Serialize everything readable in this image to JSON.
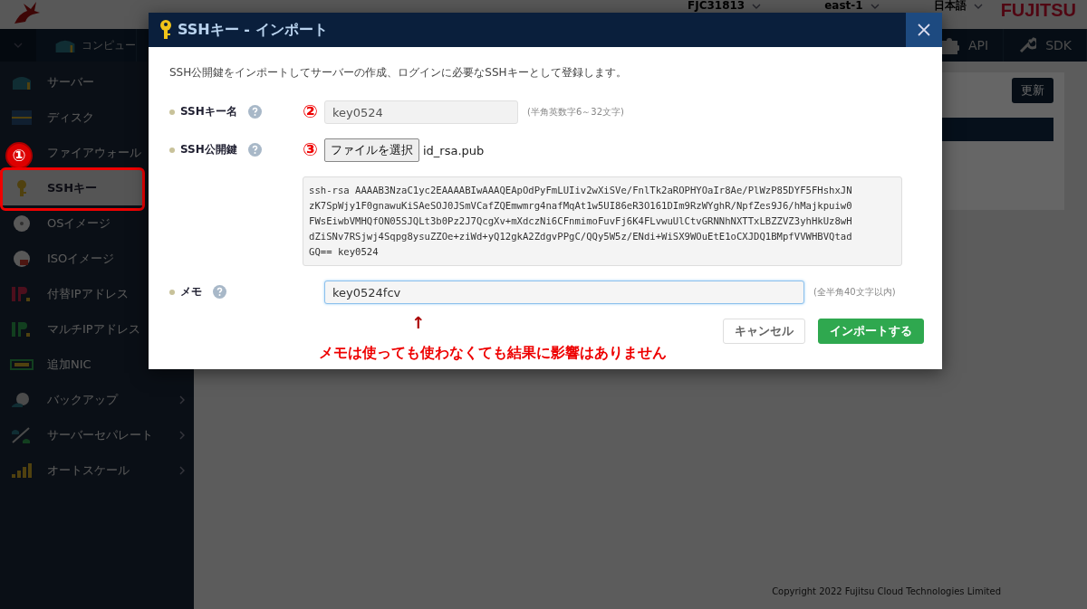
{
  "header": {
    "account": "FJC31813",
    "region": "east-1",
    "language": "日本語",
    "logo": "FUJITSU"
  },
  "navbar": {
    "items": [
      {
        "label": "コンピュー"
      },
      {
        "label": "API"
      },
      {
        "label": "SDK"
      }
    ]
  },
  "sidebar": {
    "items": [
      {
        "label": "サーバー",
        "selected": false
      },
      {
        "label": "ディスク",
        "selected": false
      },
      {
        "label": "ファイアウォール",
        "selected": false
      },
      {
        "label": "SSHキー",
        "selected": true
      },
      {
        "label": "OSイメージ",
        "selected": false
      },
      {
        "label": "ISOイメージ",
        "selected": false
      },
      {
        "label": "付替IPアドレス",
        "selected": false
      },
      {
        "label": "マルチIPアドレス",
        "selected": false
      },
      {
        "label": "追加NIC",
        "selected": false
      },
      {
        "label": "バックアップ",
        "selected": false,
        "submenu": true
      },
      {
        "label": "サーバーセパレート",
        "selected": false,
        "submenu": true
      },
      {
        "label": "オートスケール",
        "selected": false,
        "submenu": true
      }
    ]
  },
  "refresh_button": "更新",
  "footer": "Copyright 2022 Fujitsu Cloud Technologies Limited",
  "dialog": {
    "title": "SSHキー - インポート",
    "description": "SSH公開鍵をインポートしてサーバーの作成、ログインに必要なSSHキーとして登録します。",
    "fields": [
      {
        "kind": "text",
        "label": "SSHキー名",
        "value": "key0524",
        "hint": "(半角英数字6～32文字)",
        "marker": "②",
        "focused": false
      },
      {
        "kind": "file",
        "label": "SSH公開鍵",
        "button": "ファイルを選択",
        "file_name": "id_rsa.pub",
        "marker": "③",
        "key_lines": [
          "ssh-rsa AAAAB3NzaC1yc2EAAAABIwAAAQEApOdPyFmLUIiv2wXiSVe/FnlTk2aROPHYOaIr8Ae/PlWzP85DYF5FHshxJN",
          "zK7SpWjy1F0gnawuKiSAeSOJ0JSmVCafZQEmwmrg4nafMqAt1w5UI86eR3O161DIm9RzWYghR/NpfZes9J6/hMajkpuiw0",
          "FWsEiwbVMHQfON05SJQLt3b0Pz2J7QcgXv+mXdczNi6CFnmimoFuvFj6K4FLvwuUlCtvGRNNhNXTTxLBZZVZ3yhHkUz8wH",
          "dZiSNv7RSjwj4Sqpg8ysuZZOe+ziWd+yQ12gkA2ZdgvPPgC/QQy5W5z/ENdi+WiSX9WOuEtE1oCXJDQ1BMpfVVWHBVQtad",
          "GQ== key0524"
        ]
      },
      {
        "kind": "text",
        "label": "メモ",
        "value": "key0524fcv",
        "hint": "(全半角40文字以内)",
        "focused": true
      }
    ],
    "buttons": [
      {
        "label": "キャンセル",
        "primary": false
      },
      {
        "label": "インポートする",
        "primary": true
      }
    ]
  },
  "annotations": {
    "sidebar_marker": "①",
    "arrow": "↑",
    "note": "メモは使っても使わなくても結果に影響はありません"
  }
}
